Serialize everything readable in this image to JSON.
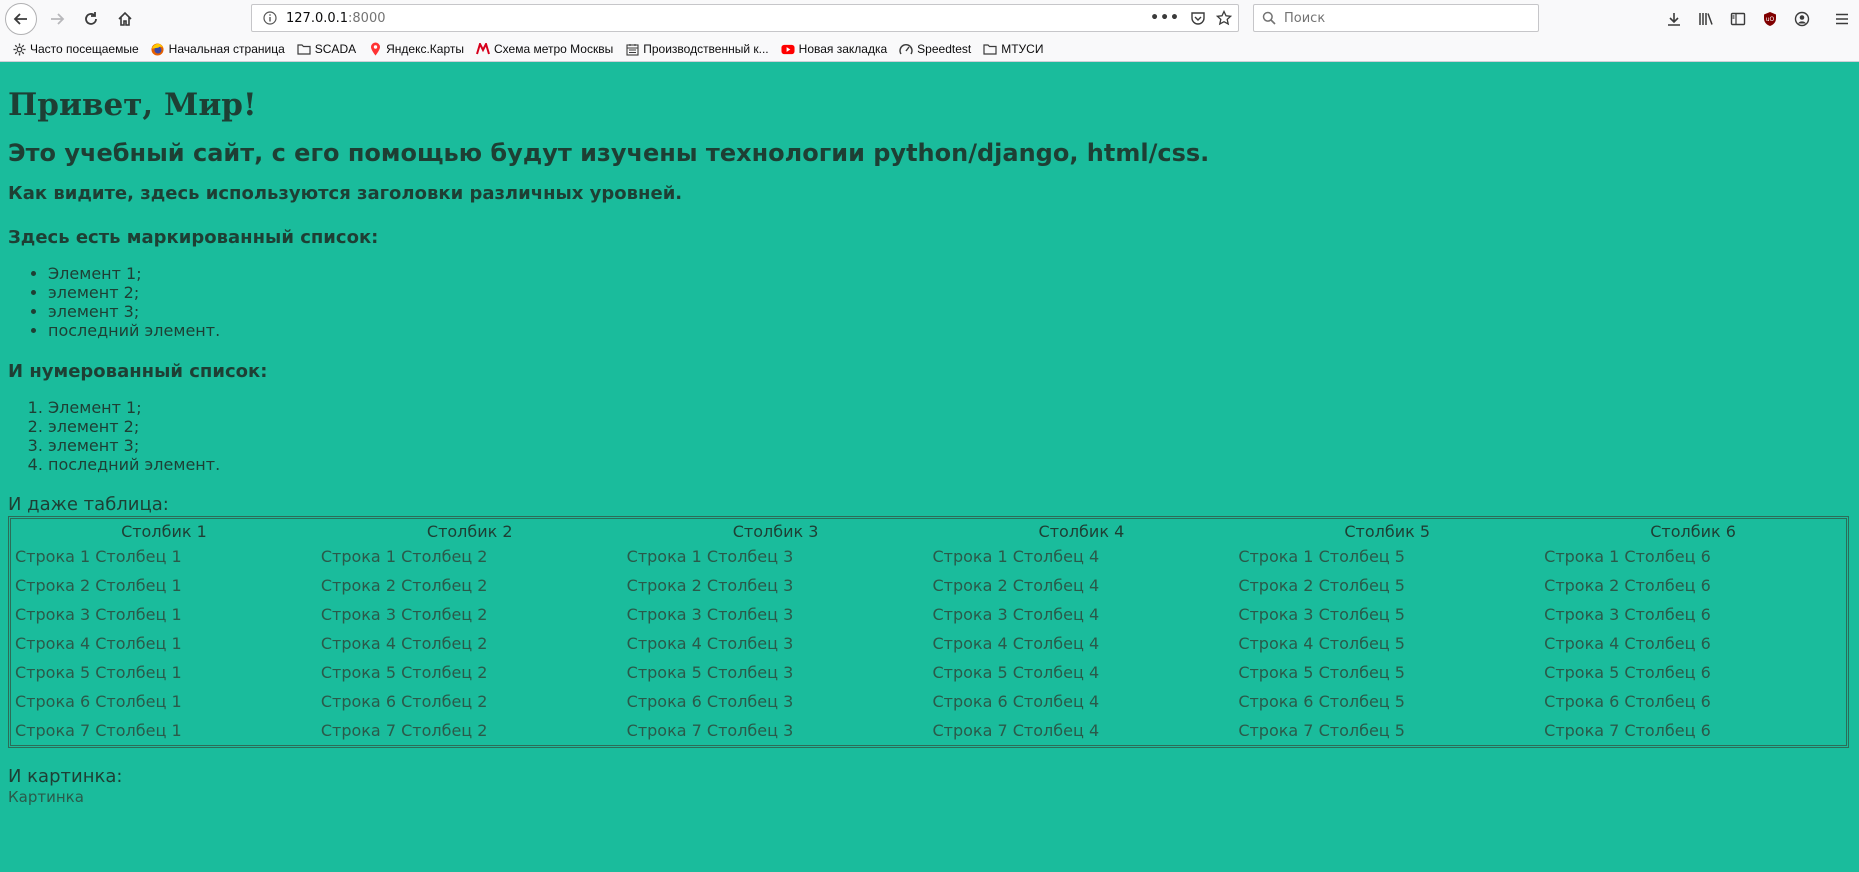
{
  "browser": {
    "url_host": "127.0.0.1",
    "url_port": ":8000",
    "search_placeholder": "Поиск",
    "bookmarks": [
      {
        "label": "Часто посещаемые",
        "icon": "gear-icon"
      },
      {
        "label": "Начальная страница",
        "icon": "firefox-icon"
      },
      {
        "label": "SCADA",
        "icon": "folder-icon"
      },
      {
        "label": "Яндекс.Карты",
        "icon": "map-pin-icon"
      },
      {
        "label": "Схема метро Москвы",
        "icon": "metro-icon"
      },
      {
        "label": "Производственный к...",
        "icon": "calendar-icon"
      },
      {
        "label": "Новая закладка",
        "icon": "youtube-icon"
      },
      {
        "label": "Speedtest",
        "icon": "speedometer-icon"
      },
      {
        "label": "МТУСИ",
        "icon": "folder-icon"
      }
    ]
  },
  "page": {
    "h1": "Привет, Мир!",
    "h2": "Это учебный сайт, с его помощью будут изучены технологии python/django, html/css.",
    "h3_intro": "Как видите, здесь используются заголовки различных уровней.",
    "h3_bullets": "Здесь есть маркированный список:",
    "bullets": [
      "Элемент 1;",
      "элемент 2;",
      "элемент 3;",
      "последний элемент."
    ],
    "h3_numbered": "И нумерованный список:",
    "numbered": [
      "Элемент 1;",
      "элемент 2;",
      "элемент 3;",
      "последний элемент."
    ],
    "table_intro": "И даже таблица:",
    "table": {
      "headers": [
        "Столбик 1",
        "Столбик 2",
        "Столбик 3",
        "Столбик 4",
        "Столбик 5",
        "Столбик 6"
      ],
      "rows": [
        [
          "Строка 1 Столбец 1",
          "Строка 1 Столбец 2",
          "Строка 1 Столбец 3",
          "Строка 1 Столбец 4",
          "Строка 1 Столбец 5",
          "Строка 1 Столбец 6"
        ],
        [
          "Строка 2 Столбец 1",
          "Строка 2 Столбец 2",
          "Строка 2 Столбец 3",
          "Строка 2 Столбец 4",
          "Строка 2 Столбец 5",
          "Строка 2 Столбец 6"
        ],
        [
          "Строка 3 Столбец 1",
          "Строка 3 Столбец 2",
          "Строка 3 Столбец 3",
          "Строка 3 Столбец 4",
          "Строка 3 Столбец 5",
          "Строка 3 Столбец 6"
        ],
        [
          "Строка 4 Столбец 1",
          "Строка 4 Столбец 2",
          "Строка 4 Столбец 3",
          "Строка 4 Столбец 4",
          "Строка 4 Столбец 5",
          "Строка 4 Столбец 6"
        ],
        [
          "Строка 5 Столбец 1",
          "Строка 5 Столбец 2",
          "Строка 5 Столбец 3",
          "Строка 5 Столбец 4",
          "Строка 5 Столбец 5",
          "Строка 5 Столбец 6"
        ],
        [
          "Строка 6 Столбец 1",
          "Строка 6 Столбец 2",
          "Строка 6 Столбец 3",
          "Строка 6 Столбец 4",
          "Строка 6 Столбец 5",
          "Строка 6 Столбец 6"
        ],
        [
          "Строка 7 Столбец 1",
          "Строка 7 Столбец 2",
          "Строка 7 Столбец 3",
          "Строка 7 Столбец 4",
          "Строка 7 Столбец 5",
          "Строка 7 Столбец 6"
        ]
      ]
    },
    "picture_intro": "И картинка:",
    "picture_alt": "Картинка"
  },
  "colors": {
    "page_background": "#1abc9c",
    "text": "#1e3f34",
    "table_border": "#2c6d58"
  }
}
